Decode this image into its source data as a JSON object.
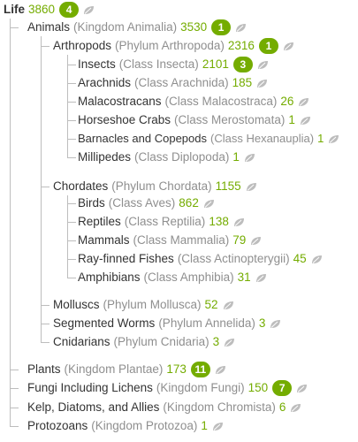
{
  "leaf_icon": "leaf-icon",
  "accent_color": "#74ac00",
  "root": {
    "name": "Life",
    "count": "3860",
    "badge": "4"
  },
  "nodes": [
    {
      "key": "animals",
      "name": "Animals",
      "sci": "(Kingdom Animalia)",
      "count": "3530",
      "badge": "1"
    },
    {
      "key": "arthropods",
      "name": "Arthropods",
      "sci": "(Phylum Arthropoda)",
      "count": "2316",
      "badge": "1"
    },
    {
      "key": "insects",
      "name": "Insects",
      "sci": "(Class Insecta)",
      "count": "2101",
      "badge": "3"
    },
    {
      "key": "arachnids",
      "name": "Arachnids",
      "sci": "(Class Arachnida)",
      "count": "185"
    },
    {
      "key": "malacostracans",
      "name": "Malacostracans",
      "sci": "(Class Malacostraca)",
      "count": "26"
    },
    {
      "key": "horseshoe-crabs",
      "name": "Horseshoe Crabs",
      "sci": "(Class Merostomata)",
      "count": "1"
    },
    {
      "key": "barnacles",
      "name": "Barnacles and Copepods",
      "sci": "(Class Hexanauplia)",
      "count": "1"
    },
    {
      "key": "millipedes",
      "name": "Millipedes",
      "sci": "(Class Diplopoda)",
      "count": "1"
    },
    {
      "key": "chordates",
      "name": "Chordates",
      "sci": "(Phylum Chordata)",
      "count": "1155"
    },
    {
      "key": "birds",
      "name": "Birds",
      "sci": "(Class Aves)",
      "count": "862"
    },
    {
      "key": "reptiles",
      "name": "Reptiles",
      "sci": "(Class Reptilia)",
      "count": "138"
    },
    {
      "key": "mammals",
      "name": "Mammals",
      "sci": "(Class Mammalia)",
      "count": "79"
    },
    {
      "key": "ray-finned-fishes",
      "name": "Ray-finned Fishes",
      "sci": "(Class Actinopterygii)",
      "count": "45"
    },
    {
      "key": "amphibians",
      "name": "Amphibians",
      "sci": "(Class Amphibia)",
      "count": "31"
    },
    {
      "key": "molluscs",
      "name": "Molluscs",
      "sci": "(Phylum Mollusca)",
      "count": "52"
    },
    {
      "key": "segmented-worms",
      "name": "Segmented Worms",
      "sci": "(Phylum Annelida)",
      "count": "3"
    },
    {
      "key": "cnidarians",
      "name": "Cnidarians",
      "sci": "(Phylum Cnidaria)",
      "count": "3"
    },
    {
      "key": "plants",
      "name": "Plants",
      "sci": "(Kingdom Plantae)",
      "count": "173",
      "badge": "11"
    },
    {
      "key": "fungi",
      "name": "Fungi Including Lichens",
      "sci": "(Kingdom Fungi)",
      "count": "150",
      "badge": "7"
    },
    {
      "key": "kelp",
      "name": "Kelp, Diatoms, and Allies",
      "sci": "(Kingdom Chromista)",
      "count": "6"
    },
    {
      "key": "protozoans",
      "name": "Protozoans",
      "sci": "(Kingdom Protozoa)",
      "count": "1"
    }
  ]
}
